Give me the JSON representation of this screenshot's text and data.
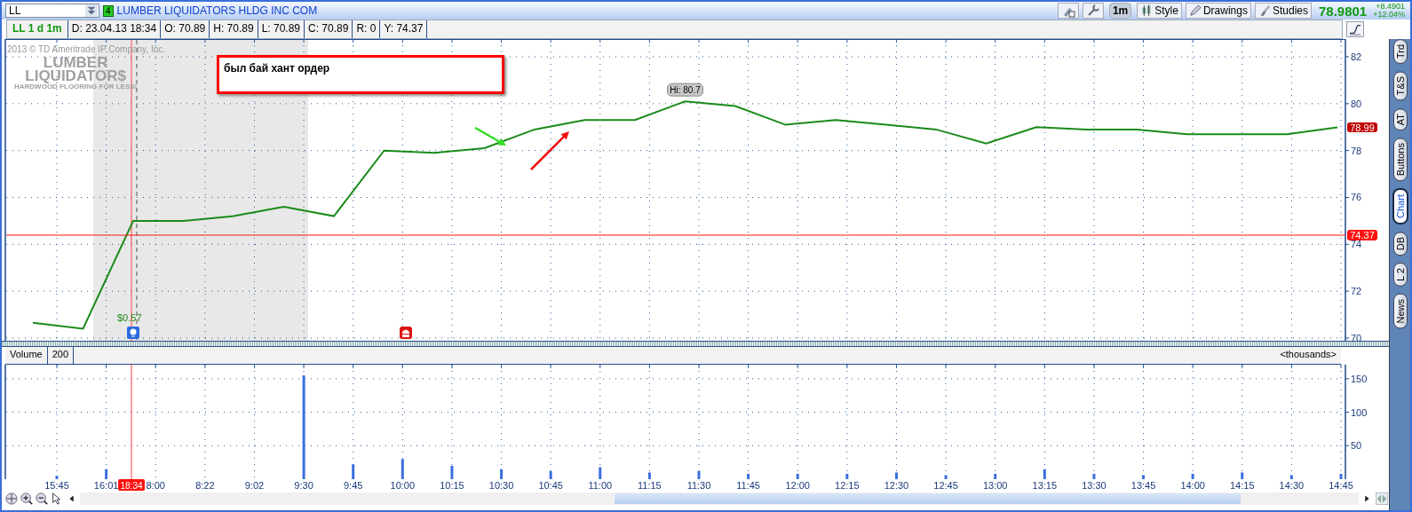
{
  "header": {
    "symbol": "LL",
    "link_badge": "4",
    "description": "LUMBER LIQUIDATORS HLDG INC COM",
    "tools": [
      {
        "kind": "icon"
      },
      {
        "kind": "icon"
      },
      {
        "kind": "pill",
        "label": "1m"
      },
      {
        "kind": "text",
        "label": "Style"
      },
      {
        "kind": "text",
        "label": "Drawings"
      },
      {
        "kind": "text",
        "label": "Studies"
      }
    ],
    "last_price": "78.9801",
    "change": "+8.4901",
    "change_pct": "+12.04%"
  },
  "info_bar": [
    {
      "kind": "title",
      "text": "LL 1 d 1m"
    },
    {
      "kind": "field",
      "text": "D: 23.04.13 18:34"
    },
    {
      "kind": "field",
      "text": "O: 70.89"
    },
    {
      "kind": "field",
      "text": "H: 70.89"
    },
    {
      "kind": "field",
      "text": "L: 70.89"
    },
    {
      "kind": "field",
      "text": "C: 70.89"
    },
    {
      "kind": "field",
      "text": "R: 0"
    },
    {
      "kind": "field",
      "text": "Y: 74.37"
    }
  ],
  "price_chart": {
    "copyright": "2013 © TD Ameritrade IP Company, Inc.",
    "logo": [
      "LUMBER",
      "LIQUIDATOR$",
      "HARDWOOD FLOORING FOR LESS!"
    ],
    "note": "был бай хант ордер",
    "hi_label": "Hi: 80.7",
    "dividend_label": "$0.57",
    "last_tag": {
      "label": "78.99",
      "color": "#c00000"
    },
    "prev_close_tag": {
      "label": "74.37",
      "color": "#ff1010"
    },
    "chart_data": {
      "type": "line",
      "ylim": [
        69.886,
        82.757
      ],
      "yticks": [
        70,
        72,
        74,
        76,
        78,
        80,
        82
      ],
      "grid": true,
      "values": [
        70.65,
        70.4,
        75.0,
        75.0,
        75.2,
        75.6,
        75.2,
        78.0,
        77.9,
        78.1,
        78.9,
        79.3,
        79.3,
        80.1,
        79.9,
        79.1,
        79.3,
        79.1,
        78.9,
        78.3,
        79.0,
        78.9,
        78.9,
        78.7,
        78.7,
        78.7,
        78.99
      ]
    }
  },
  "volume_chart": {
    "title": "Volume",
    "period": "200",
    "units": "<thousands>",
    "cursor_time": "18:34",
    "chart_data": {
      "type": "bar",
      "ylim": [
        0,
        171
      ],
      "yticks": [
        50,
        100,
        150
      ],
      "grid": true,
      "categories": [
        "15:45",
        "16:01",
        "8:00",
        "8:22",
        "9:02",
        "9:30",
        "9:45",
        "10:00",
        "10:15",
        "10:30",
        "10:45",
        "11:00",
        "11:15",
        "11:30",
        "11:45",
        "12:00",
        "12:15",
        "12:30",
        "12:45",
        "13:00",
        "13:15",
        "13:30",
        "13:45",
        "14:00",
        "14:15",
        "14:30",
        "14:45"
      ],
      "values": [
        5,
        15,
        null,
        null,
        null,
        155,
        22,
        30,
        20,
        15,
        12,
        18,
        10,
        12,
        8,
        8,
        8,
        10,
        6,
        8,
        15,
        8,
        6,
        8,
        10,
        6,
        8
      ]
    }
  },
  "side_tabs": [
    {
      "label": "Trd",
      "selected": false
    },
    {
      "label": "T&S",
      "selected": false
    },
    {
      "label": "AT",
      "selected": false
    },
    {
      "label": "Buttons",
      "selected": false
    },
    {
      "label": "Chart",
      "selected": true
    },
    {
      "label": "DB",
      "selected": false
    },
    {
      "label": "L 2",
      "selected": false
    },
    {
      "label": "News",
      "selected": false
    }
  ]
}
